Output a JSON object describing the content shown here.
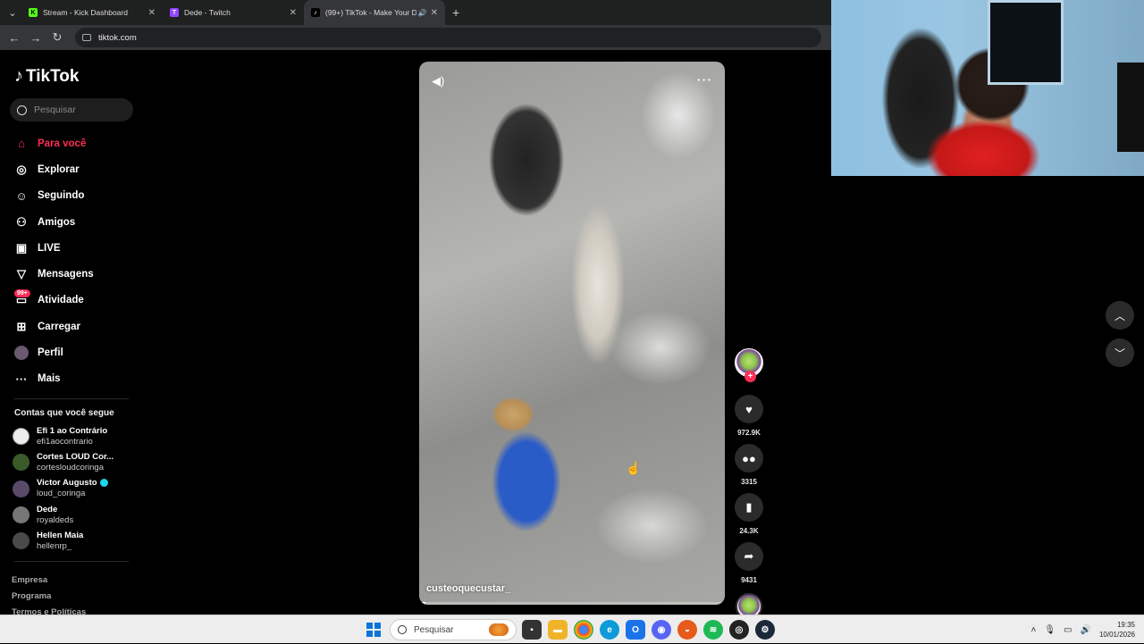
{
  "browser": {
    "tabs": [
      {
        "title": "Stream - Kick Dashboard",
        "favicon_color": "#53fc18",
        "favicon_letter": "K"
      },
      {
        "title": "Dede - Twitch",
        "favicon_color": "#9146ff",
        "favicon_letter": "T"
      },
      {
        "title": "(99+) TikTok - Make Your D...",
        "favicon_color": "#000000",
        "favicon_letter": "♪"
      }
    ],
    "url": "tiktok.com"
  },
  "tiktok": {
    "logo_text": "TikTok",
    "search_placeholder": "Pesquisar",
    "menu": [
      {
        "label": "Para você",
        "icon": "home-icon"
      },
      {
        "label": "Explorar",
        "icon": "compass-icon"
      },
      {
        "label": "Seguindo",
        "icon": "following-icon"
      },
      {
        "label": "Amigos",
        "icon": "friends-icon"
      },
      {
        "label": "LIVE",
        "icon": "live-icon"
      },
      {
        "label": "Mensagens",
        "icon": "messages-icon"
      },
      {
        "label": "Atividade",
        "icon": "activity-icon",
        "badge": "99+"
      },
      {
        "label": "Carregar",
        "icon": "upload-icon"
      },
      {
        "label": "Perfil",
        "icon": "profile-icon"
      },
      {
        "label": "Mais",
        "icon": "more-icon"
      }
    ],
    "following_header": "Contas que você segue",
    "following": [
      {
        "name": "Efi 1 ao Contrário",
        "handle": "efi1aocontrario",
        "verified": false,
        "color": "#eeeeee"
      },
      {
        "name": "Cortes LOUD Cor...",
        "handle": "cortesloudcoringa",
        "verified": false,
        "color": "#3a5a2a"
      },
      {
        "name": "Victor Augusto",
        "handle": "loud_coringa",
        "verified": true,
        "color": "#5a4a6a"
      },
      {
        "name": "Dede",
        "handle": "royaldeds",
        "verified": false,
        "color": "#777777"
      },
      {
        "name": "Hellen Maia",
        "handle": "hellenrp_",
        "verified": false,
        "color": "#4a4a4a"
      }
    ],
    "footer": [
      "Empresa",
      "Programa",
      "Termos e Políticas"
    ],
    "video": {
      "author": "custeoquecustar_",
      "progress": 0.02
    },
    "actions": {
      "likes": "972.9K",
      "comments": "3315",
      "saves": "24.3K",
      "shares": "9431"
    }
  },
  "taskbar": {
    "search_placeholder": "Pesquisar",
    "time": "19:35",
    "date": "10/01/2026"
  }
}
